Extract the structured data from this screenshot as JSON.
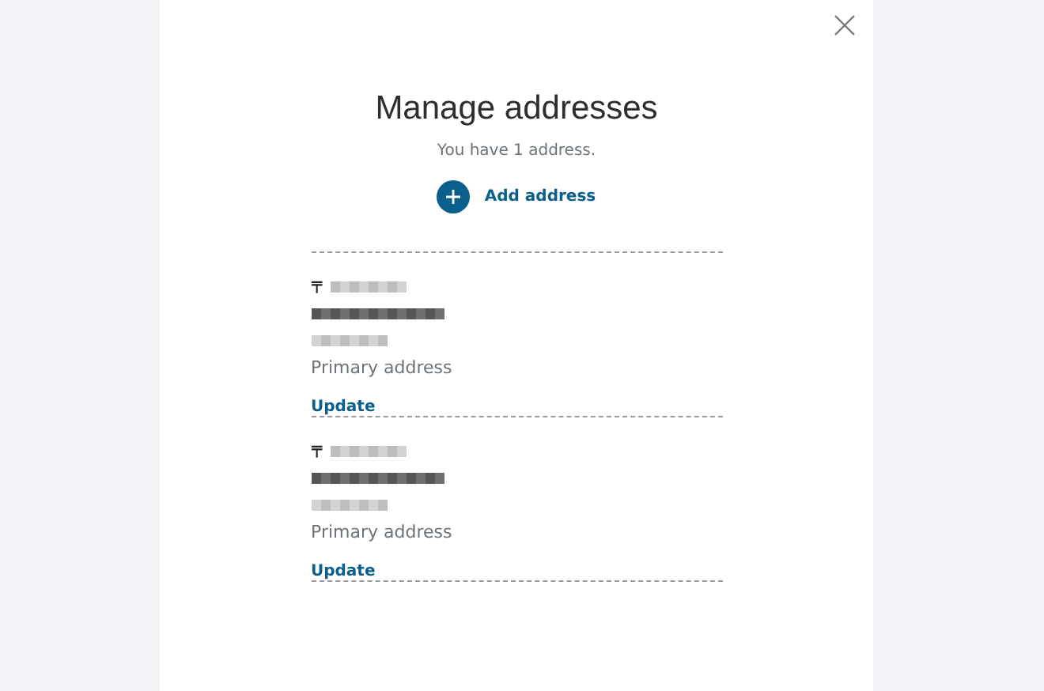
{
  "dialog": {
    "title": "Manage addresses",
    "subtitle": "You have 1 address.",
    "add_button": "Add address"
  },
  "addresses": [
    {
      "postal_mark": "〒",
      "label": "Primary address",
      "action": "Update"
    },
    {
      "postal_mark": "〒",
      "label": "Primary address",
      "action": "Update"
    }
  ]
}
